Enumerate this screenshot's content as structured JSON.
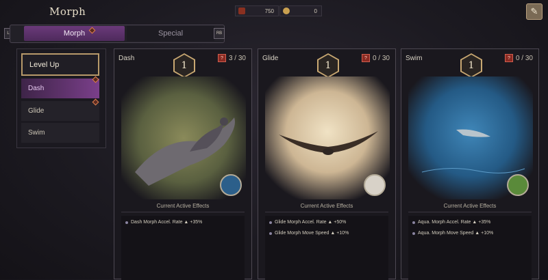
{
  "header": {
    "title": "Morph"
  },
  "currency": [
    {
      "icon": "feather-currency-icon",
      "value": "750"
    },
    {
      "icon": "gold-coin-icon",
      "value": "0"
    }
  ],
  "tabs": {
    "left_button": "LB",
    "right_button": "RB",
    "morph": "Morph",
    "special": "Special"
  },
  "sidebar": {
    "items": [
      {
        "label": "Level Up"
      },
      {
        "label": "Dash"
      },
      {
        "label": "Glide"
      },
      {
        "label": "Swim"
      }
    ]
  },
  "cards": [
    {
      "name": "Dash",
      "count": "3 / 30",
      "level": "1",
      "effects_title": "Current Active Effects",
      "effects": [
        "Dash Morph Accel. Rate ▲ +35%"
      ]
    },
    {
      "name": "Glide",
      "count": "0 / 30",
      "level": "1",
      "effects_title": "Current Active Effects",
      "effects": [
        "Glide Morph Accel. Rate ▲ +50%",
        "Glide Morph Move Speed ▲ +10%"
      ]
    },
    {
      "name": "Swim",
      "count": "0 / 30",
      "level": "1",
      "effects_title": "Current Active Effects",
      "effects": [
        "Aqua. Morph Accel. Rate ▲ +35%",
        "Aqua. Morph Move Speed ▲ +10%"
      ]
    }
  ],
  "colors": {
    "accent": "#7a3f8a",
    "gold": "#c9a872",
    "alert": "#d06050"
  }
}
